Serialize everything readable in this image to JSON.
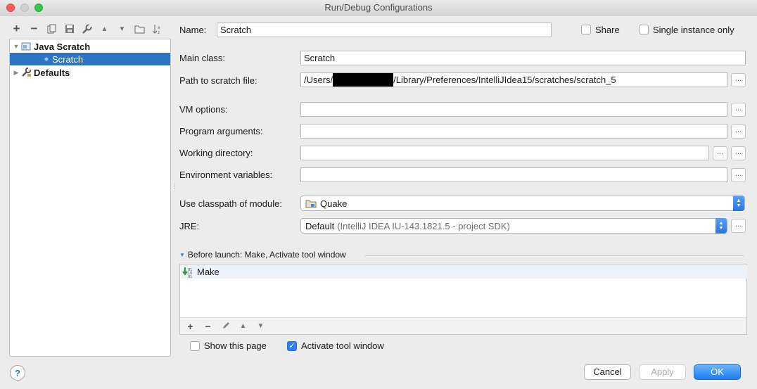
{
  "window": {
    "title": "Run/Debug Configurations"
  },
  "toolbar": {
    "buttons": [
      "plus-icon",
      "minus-icon",
      "copy-icon",
      "save-icon",
      "wrench-icon",
      "arrow-up-icon",
      "arrow-down-icon",
      "folder-icon",
      "sort-icon"
    ]
  },
  "tree": {
    "java_scratch": "Java Scratch",
    "scratch": "Scratch",
    "defaults": "Defaults"
  },
  "form": {
    "name_label": "Name:",
    "name_value": "Scratch",
    "share_label": "Share",
    "share_checked": false,
    "single_instance_label": "Single instance only",
    "single_instance_checked": false,
    "main_class_label": "Main class:",
    "main_class_value": "Scratch",
    "path_label": "Path to scratch file:",
    "path_prefix": "/Users/",
    "path_suffix": "/Library/Preferences/IntelliJIdea15/scratches/scratch_5",
    "vm_options_label": "VM options:",
    "vm_options_value": "",
    "program_args_label": "Program arguments:",
    "program_args_value": "",
    "working_dir_label": "Working directory:",
    "working_dir_value": "",
    "env_vars_label": "Environment variables:",
    "env_vars_value": "",
    "classpath_label": "Use classpath of module:",
    "classpath_value": "Quake",
    "jre_label": "JRE:",
    "jre_value": "Default",
    "jre_detail": "(IntelliJ IDEA IU-143.1821.5 - project SDK)",
    "browse_label": "..."
  },
  "before_launch": {
    "header": "Before launch: Make, Activate tool window",
    "items": [
      "Make"
    ],
    "show_page_label": "Show this page",
    "show_page_checked": false,
    "activate_label": "Activate tool window",
    "activate_checked": true
  },
  "buttons": {
    "cancel": "Cancel",
    "apply": "Apply",
    "ok": "OK",
    "help": "?"
  },
  "colors": {
    "selection": "#2e73c4",
    "primary": "#1b7cf2"
  }
}
